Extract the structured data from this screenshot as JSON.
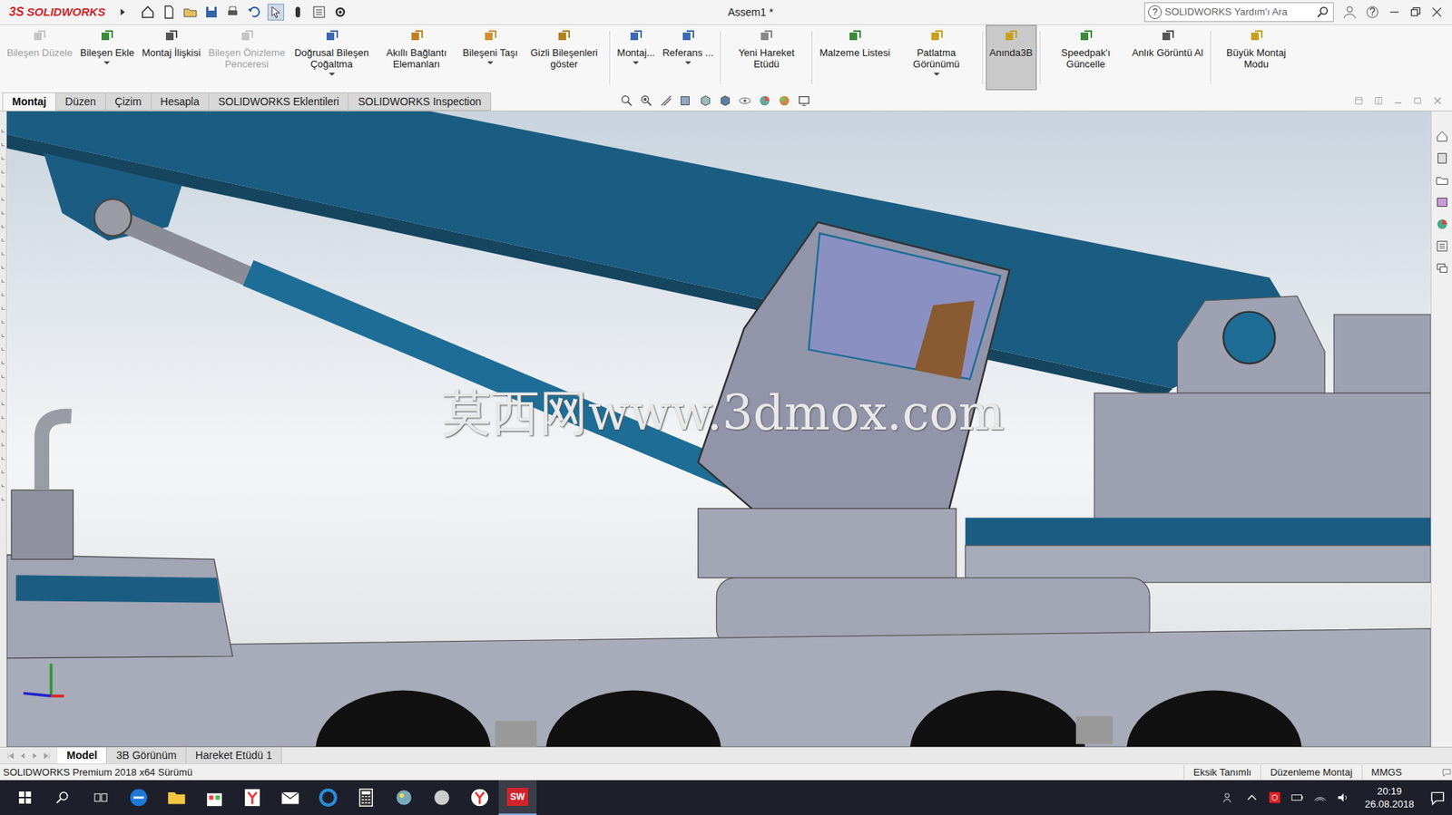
{
  "app": {
    "logo_mark": "3S",
    "logo": "SOLIDWORKS"
  },
  "window": {
    "title": "Assem1 *"
  },
  "search": {
    "placeholder": "SOLIDWORKS Yardım'ı Ara",
    "help_mark": "?"
  },
  "ribbon": [
    {
      "label": "Bileşen Düzele",
      "disabled": true,
      "selected": false,
      "dropdown": false
    },
    {
      "label": "Bileşen Ekle",
      "disabled": false,
      "selected": false,
      "dropdown": true
    },
    {
      "label": "Montaj İlişkisi",
      "disabled": false,
      "selected": false,
      "dropdown": false
    },
    {
      "label": "Bileşen Önizleme Penceresi",
      "disabled": true,
      "selected": false,
      "dropdown": false
    },
    {
      "label": "Doğrusal Bileşen Çoğaltma",
      "disabled": false,
      "selected": false,
      "dropdown": true
    },
    {
      "label": "Akıllı Bağlantı Elemanları",
      "disabled": false,
      "selected": false,
      "dropdown": false
    },
    {
      "label": "Bileşeni Taşı",
      "disabled": false,
      "selected": false,
      "dropdown": true
    },
    {
      "label": "Gizli Bileşenleri göster",
      "disabled": false,
      "selected": false,
      "dropdown": false
    },
    {
      "label": "Montaj...",
      "disabled": false,
      "selected": false,
      "dropdown": true
    },
    {
      "label": "Referans ...",
      "disabled": false,
      "selected": false,
      "dropdown": true
    },
    {
      "label": "Yeni Hareket Etüdü",
      "disabled": false,
      "selected": false,
      "dropdown": false
    },
    {
      "label": "Malzeme Listesi",
      "disabled": false,
      "selected": false,
      "dropdown": false
    },
    {
      "label": "Patlatma Görünümü",
      "disabled": false,
      "selected": false,
      "dropdown": true
    },
    {
      "label": "Anında3B",
      "disabled": false,
      "selected": true,
      "dropdown": false
    },
    {
      "label": "Speedpak'ı Güncelle",
      "disabled": false,
      "selected": false,
      "dropdown": false
    },
    {
      "label": "Anlık Görüntü Al",
      "disabled": false,
      "selected": false,
      "dropdown": false
    },
    {
      "label": "Büyük Montaj Modu",
      "disabled": false,
      "selected": false,
      "dropdown": false
    }
  ],
  "tabs": [
    {
      "label": "Montaj",
      "selected": true
    },
    {
      "label": "Düzen",
      "selected": false
    },
    {
      "label": "Çizim",
      "selected": false
    },
    {
      "label": "Hesapla",
      "selected": false
    },
    {
      "label": "SOLIDWORKS Eklentileri",
      "selected": false
    },
    {
      "label": "SOLIDWORKS Inspection",
      "selected": false
    }
  ],
  "watermark": "莫西网www.3dmox.com",
  "bottom_tabs": [
    {
      "label": "Model",
      "selected": true
    },
    {
      "label": "3B Görünüm",
      "selected": false
    },
    {
      "label": "Hareket Etüdü 1",
      "selected": false
    }
  ],
  "status_bar": {
    "version": "SOLIDWORKS Premium 2018 x64 Sürümü",
    "items": [
      "Eksik Tanımlı",
      "Düzenleme Montaj",
      "MMGS"
    ]
  },
  "taskbar": {
    "sw_icon": "SW",
    "time": "20:19",
    "date": "26.08.2018"
  }
}
